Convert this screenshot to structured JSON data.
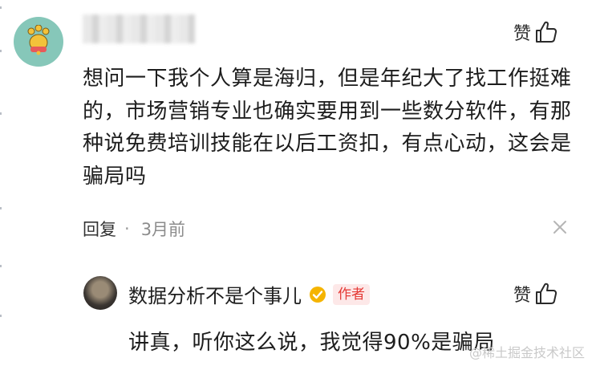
{
  "comment": {
    "text": "想问一下我个人算是海归，但是年纪大了找工作挺难的，市场营销专业也确实要用到一些数分软件，有那种说免费培训技能在以后工资扣，有点心动，这会是骗局吗",
    "like_label": "赞",
    "reply_label": "回复",
    "separator": "·",
    "time": "3月前"
  },
  "reply": {
    "author": "数据分析不是个事儿",
    "author_badge": "作者",
    "like_label": "赞",
    "text": "讲真，听你这么说，我觉得90%是骗局"
  },
  "watermark": "@稀土掘金技术社区",
  "colors": {
    "avatar_bg": "#86c7b9",
    "badge_red": "#e53935",
    "verified_gold": "#f5b400"
  },
  "icons": [
    "paw-avatar",
    "thumbs-up-icon",
    "close-icon",
    "verified-icon"
  ]
}
